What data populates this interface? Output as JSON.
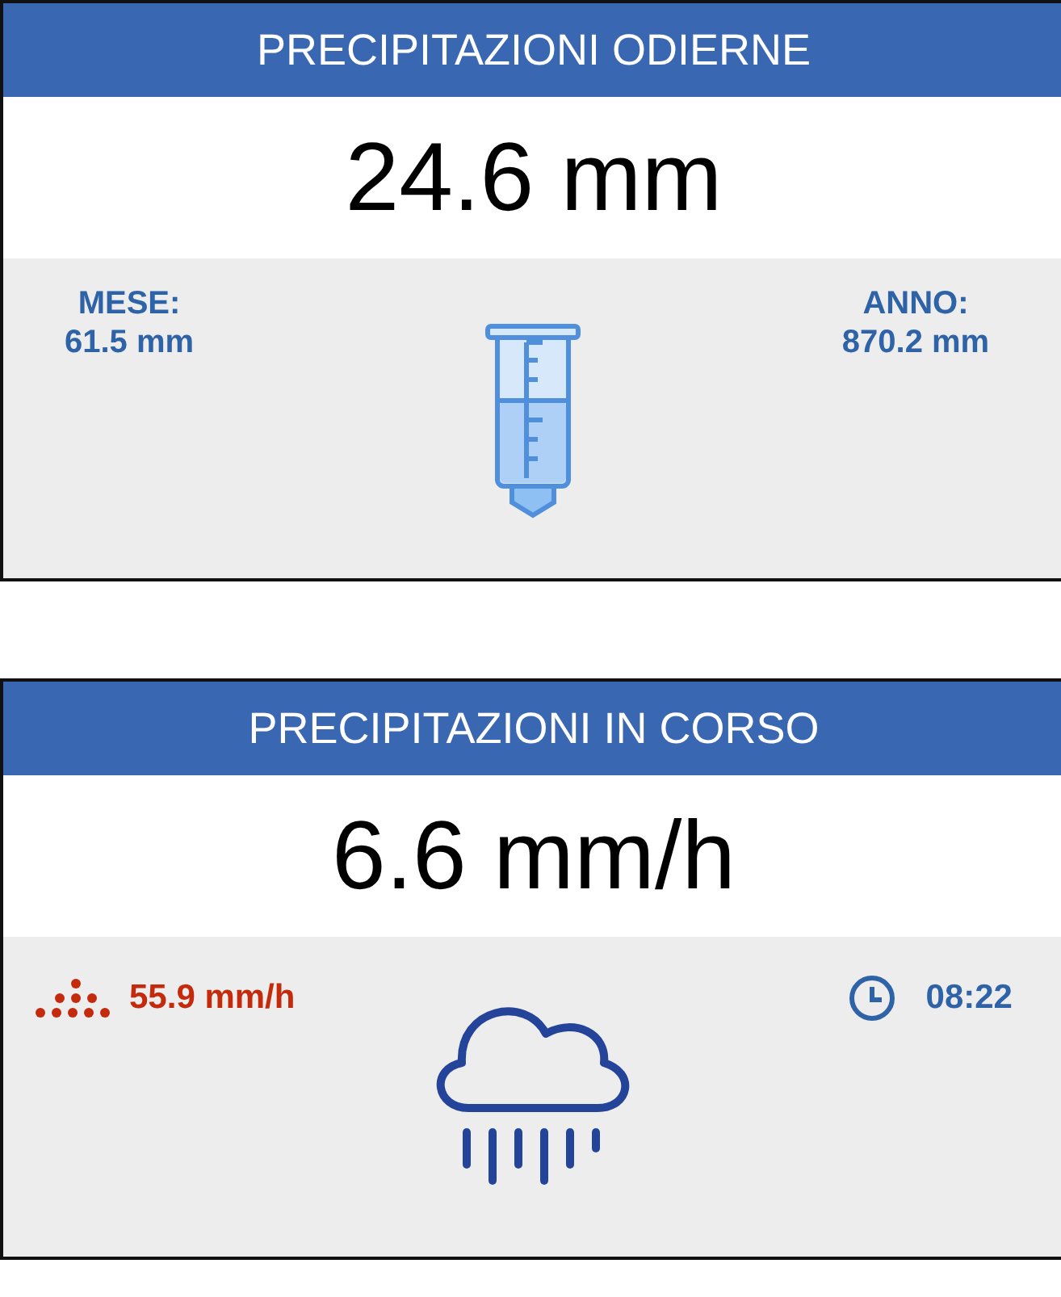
{
  "panels": [
    {
      "kind": "gauge",
      "title": "PRECIPITAZIONI ODIERNE",
      "value": "24.6 mm",
      "left": {
        "kind": "stat",
        "label": "MESE:",
        "value": "61.5 mm"
      },
      "right": {
        "kind": "stat",
        "label": "ANNO:",
        "value": "870.2 mm"
      }
    },
    {
      "kind": "rain",
      "title": "PRECIPITAZIONI IN CORSO",
      "value": "6.6 mm/h",
      "left": {
        "kind": "peak",
        "value": "55.9 mm/h"
      },
      "right": {
        "kind": "time",
        "value": "08:22"
      }
    }
  ]
}
